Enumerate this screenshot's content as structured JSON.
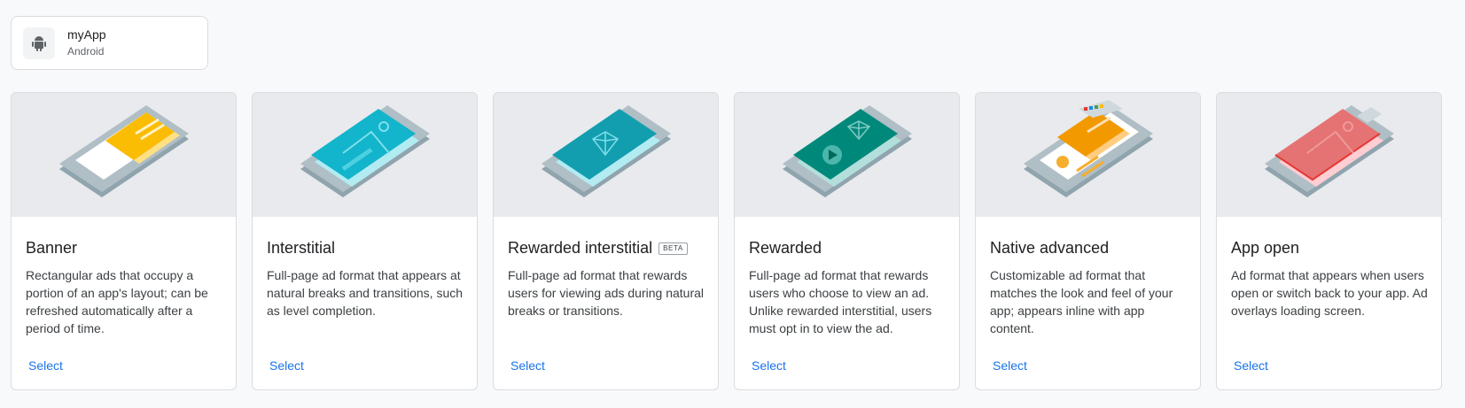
{
  "app": {
    "name": "myApp",
    "platform": "Android",
    "icon": "android-icon"
  },
  "cards": [
    {
      "title": "Banner",
      "description": "Rectangular ads that occupy a portion of an app's layout; can be refreshed automatically after a period of time.",
      "select_label": "Select",
      "badge": ""
    },
    {
      "title": "Interstitial",
      "description": "Full-page ad format that appears at natural breaks and transitions, such as level completion.",
      "select_label": "Select",
      "badge": ""
    },
    {
      "title": "Rewarded interstitial",
      "description": "Full-page ad format that rewards users for viewing ads during natural breaks or transitions.",
      "select_label": "Select",
      "badge": "BETA"
    },
    {
      "title": "Rewarded",
      "description": "Full-page ad format that rewards users who choose to view an ad. Unlike rewarded interstitial, users must opt in to view the ad.",
      "select_label": "Select",
      "badge": ""
    },
    {
      "title": "Native advanced",
      "description": "Customizable ad format that matches the look and feel of your app; appears inline with app content.",
      "select_label": "Select",
      "badge": ""
    },
    {
      "title": "App open",
      "description": "Ad format that appears when users open or switch back to your app. Ad overlays loading screen.",
      "select_label": "Select",
      "badge": ""
    }
  ],
  "colors": {
    "accent": "#1a73e8",
    "banner": "#fbbc04",
    "interstitial": "#12b5cb",
    "rewarded_interstitial": "#129eaf",
    "rewarded": "#00897b",
    "native": "#f29900",
    "app_open": "#e57373"
  }
}
